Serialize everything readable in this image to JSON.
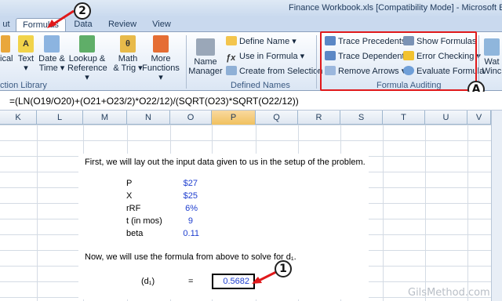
{
  "window": {
    "title": "Finance Workbook.xls  [Compatibility Mode] - Microsoft E"
  },
  "tabs": [
    {
      "label": "ut",
      "active": false
    },
    {
      "label": "Formulas",
      "active": true
    },
    {
      "label": "Data",
      "active": false
    },
    {
      "label": "Review",
      "active": false
    },
    {
      "label": "View",
      "active": false
    }
  ],
  "ribbon": {
    "function_library": {
      "label": "ction Library",
      "buttons": [
        {
          "l1": "ical",
          "l2": ""
        },
        {
          "l1": "Text",
          "l2": "▾"
        },
        {
          "l1": "Date &",
          "l2": "Time ▾"
        },
        {
          "l1": "Lookup &",
          "l2": "Reference ▾"
        },
        {
          "l1": "Math",
          "l2": "& Trig ▾"
        },
        {
          "l1": "More",
          "l2": "Functions ▾"
        }
      ]
    },
    "defined_names": {
      "label": "Defined Names",
      "name_manager": {
        "l1": "Name",
        "l2": "Manager"
      },
      "items": [
        "Define Name ▾",
        "Use in Formula ▾",
        "Create from Selection"
      ]
    },
    "formula_auditing": {
      "label": "Formula Auditing",
      "items_left": [
        "Trace Precedents",
        "Trace Dependents",
        "Remove Arrows ▾"
      ],
      "items_right": [
        "Show Formulas",
        "Error Checking ▾",
        "Evaluate Formula"
      ]
    },
    "watch": {
      "l1": "Wat",
      "l2": "Winc"
    }
  },
  "callouts": {
    "one": "1",
    "two": "2",
    "a": "A"
  },
  "formula_bar": {
    "formula": "=(LN(O19/O20)+(O21+O23/2)*O22/12)/(SQRT(O23)*SQRT(O22/12))"
  },
  "columns": [
    "K",
    "L",
    "M",
    "N",
    "O",
    "P",
    "Q",
    "R",
    "S",
    "T",
    "U",
    "V"
  ],
  "sheet": {
    "intro": "First, we will lay out the input data given to us in the setup of the problem.",
    "inputs": [
      {
        "label": "P",
        "value": "$27"
      },
      {
        "label": "X",
        "value": "$25"
      },
      {
        "label": "rRF",
        "value": "6%"
      },
      {
        "label": "t (in mos)",
        "value": "9"
      },
      {
        "label": "beta",
        "value": "0.11"
      }
    ],
    "solve_text": "Now, we will use the formula from above to solve for d₁.",
    "d1_label": "(d₁)",
    "equals": "=",
    "d1_value": "0.5682"
  },
  "watermark": "GilsMethod.com",
  "colors": {
    "accent_red": "#e0191b",
    "value_blue": "#1f3fcf"
  }
}
